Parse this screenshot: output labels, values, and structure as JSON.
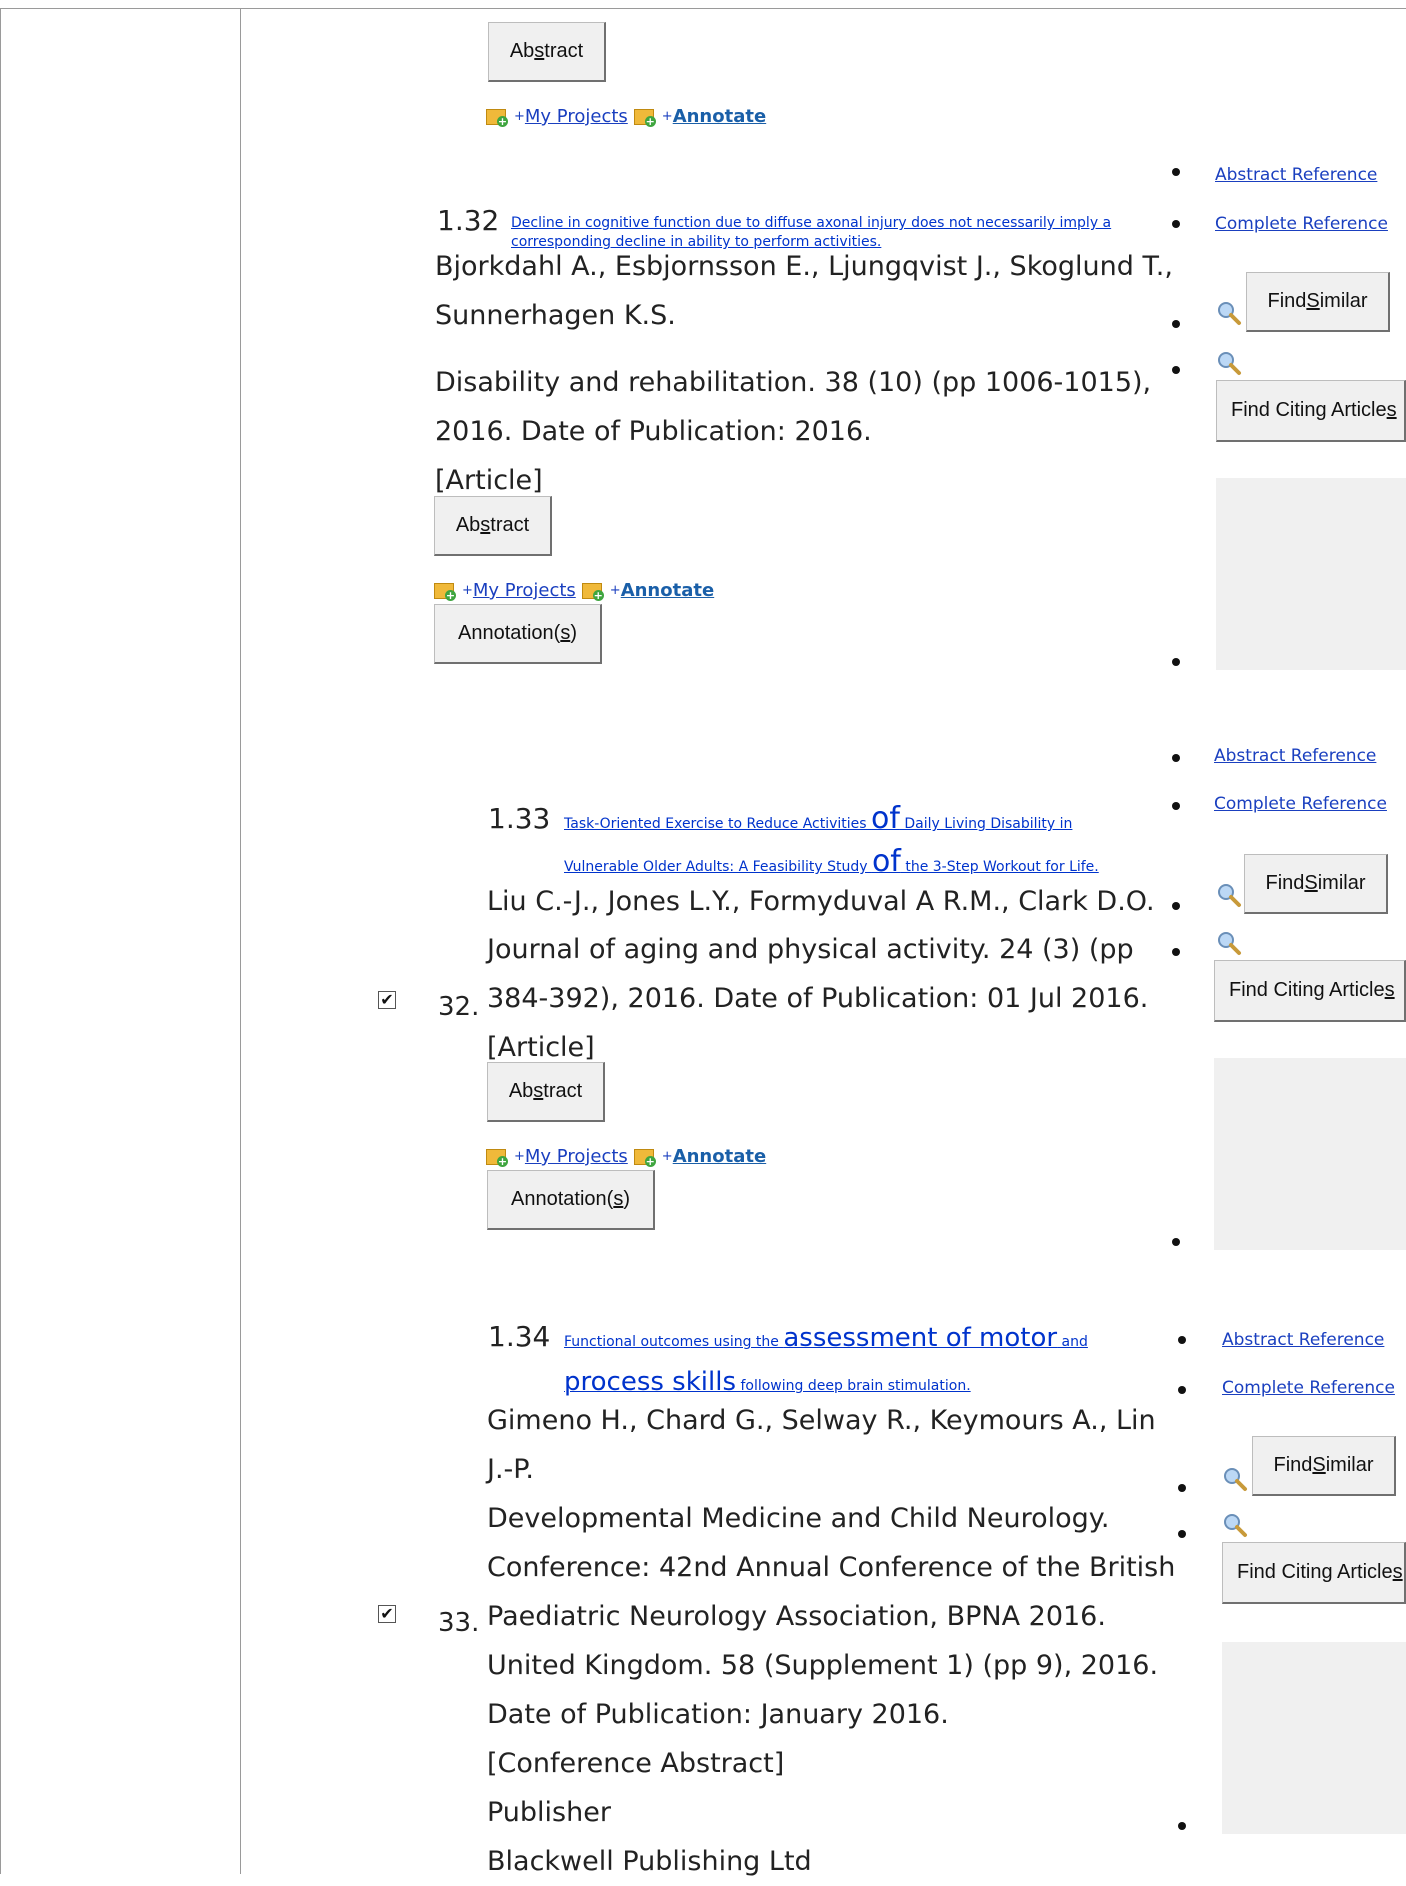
{
  "common": {
    "abstract_btn": "Abstract",
    "annotations_btn": "Annotation(s)",
    "find_similar_btn": "Find Similar",
    "find_citing_btn": "Find Citing Articles",
    "my_projects": "My Projects",
    "annotate": "Annotate",
    "plus": "+",
    "abstract_reference": "Abstract Reference",
    "complete_reference": "Complete Reference"
  },
  "records": [
    {
      "item_number": "1.32",
      "title": "Decline in cognitive function due to diffuse axonal injury does not necessarily imply a corresponding decline in ability to perform activities.",
      "authors_line1": "Bjorkdahl A., Esbjornsson E., Ljungqvist J., Skoglund T.,",
      "authors_line2": "Sunnerhagen K.S.",
      "source_line1": "Disability and rehabilitation. 38 (10) (pp 1006-1015),",
      "source_line2": "2016. Date of Publication: 2016.",
      "pub_type": "[Article]"
    },
    {
      "row_number": "32.",
      "item_number": "1.33",
      "title_a": "Task-Oriented Exercise to Reduce Activities ",
      "title_of1": "of",
      "title_b": " Daily Living Disability in",
      "title_c": "Vulnerable Older Adults: A Feasibility Study ",
      "title_of2": "of",
      "title_d": " the 3-Step Workout for Life.",
      "authors_line1": "Liu C.-J., Jones L.Y., Formyduval A R.M., Clark D.O.",
      "source_line1": "Journal of aging and physical activity. 24 (3) (pp",
      "source_line2": "384-392), 2016. Date of Publication: 01 Jul 2016.",
      "pub_type": "[Article]"
    },
    {
      "row_number": "33.",
      "item_number": "1.34",
      "title_a": "Functional outcomes using the ",
      "title_kw1": "assessment of motor",
      "title_b": " and",
      "title_kw2": "process skills",
      "title_c": " following deep brain stimulation.",
      "authors_line1": "Gimeno H., Chard G., Selway R., Keymours A., Lin",
      "authors_line2": "J.-P.",
      "source_line1": "Developmental Medicine and Child Neurology.",
      "source_line2": "Conference: 42nd Annual Conference of the British",
      "source_line3": "Paediatric Neurology Association, BPNA 2016.",
      "source_line4": "United Kingdom. 58 (Supplement 1) (pp 9), 2016.",
      "source_line5": "Date of Publication: January 2016.",
      "pub_type": "[Conference Abstract]",
      "publisher_label": "Publisher",
      "publisher_name": "Blackwell Publishing Ltd"
    }
  ]
}
